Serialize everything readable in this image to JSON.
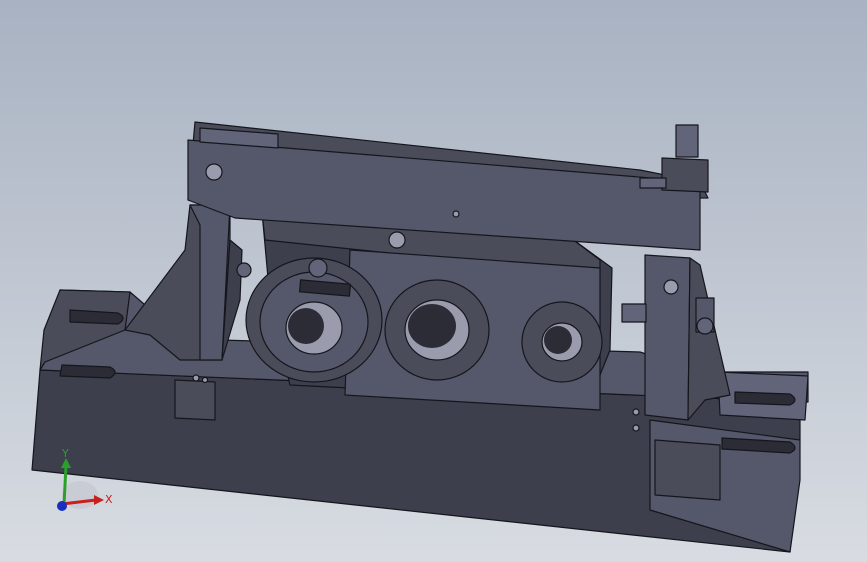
{
  "viewport": {
    "background_top": "#a8b2c2",
    "background_bottom": "#d8dce2"
  },
  "model": {
    "body_dark": "#3d3f4d",
    "body_mid": "#4a4c5a",
    "body_face": "#55576a",
    "body_light": "#62647a",
    "edge": "#15161c",
    "hole_dark": "#2b2c36",
    "hole_light": "#9a9cae"
  },
  "triad": {
    "x_label": "X",
    "y_label": "Y",
    "x_color": "#c8201e",
    "y_color": "#2aa02a",
    "z_color": "#1a2fc0"
  }
}
